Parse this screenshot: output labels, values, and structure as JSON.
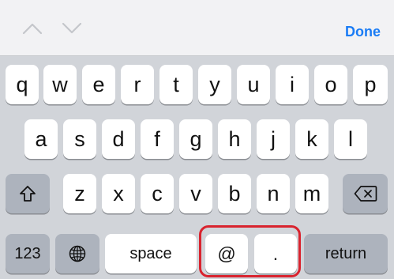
{
  "accessory_bar": {
    "done_label": "Done",
    "prev_icon": "chevron-up-icon",
    "next_icon": "chevron-down-icon"
  },
  "keyboard": {
    "row1": [
      "q",
      "w",
      "e",
      "r",
      "t",
      "y",
      "u",
      "i",
      "o",
      "p"
    ],
    "row2": [
      "a",
      "s",
      "d",
      "f",
      "g",
      "h",
      "j",
      "k",
      "l"
    ],
    "row3": [
      "z",
      "x",
      "c",
      "v",
      "b",
      "n",
      "m"
    ],
    "bottom": {
      "numbers_label": "123",
      "globe_icon": "globe-icon",
      "space_label": "space",
      "at_label": "@",
      "dot_label": ".",
      "return_label": "return"
    },
    "shift_icon": "shift-icon",
    "delete_icon": "backspace-icon"
  },
  "colors": {
    "accent": "#1a7cf5",
    "highlight": "#d9232e",
    "keyboard_bg": "#d1d4d9",
    "key_bg": "#ffffff",
    "dark_key_bg": "#adb3bd"
  }
}
